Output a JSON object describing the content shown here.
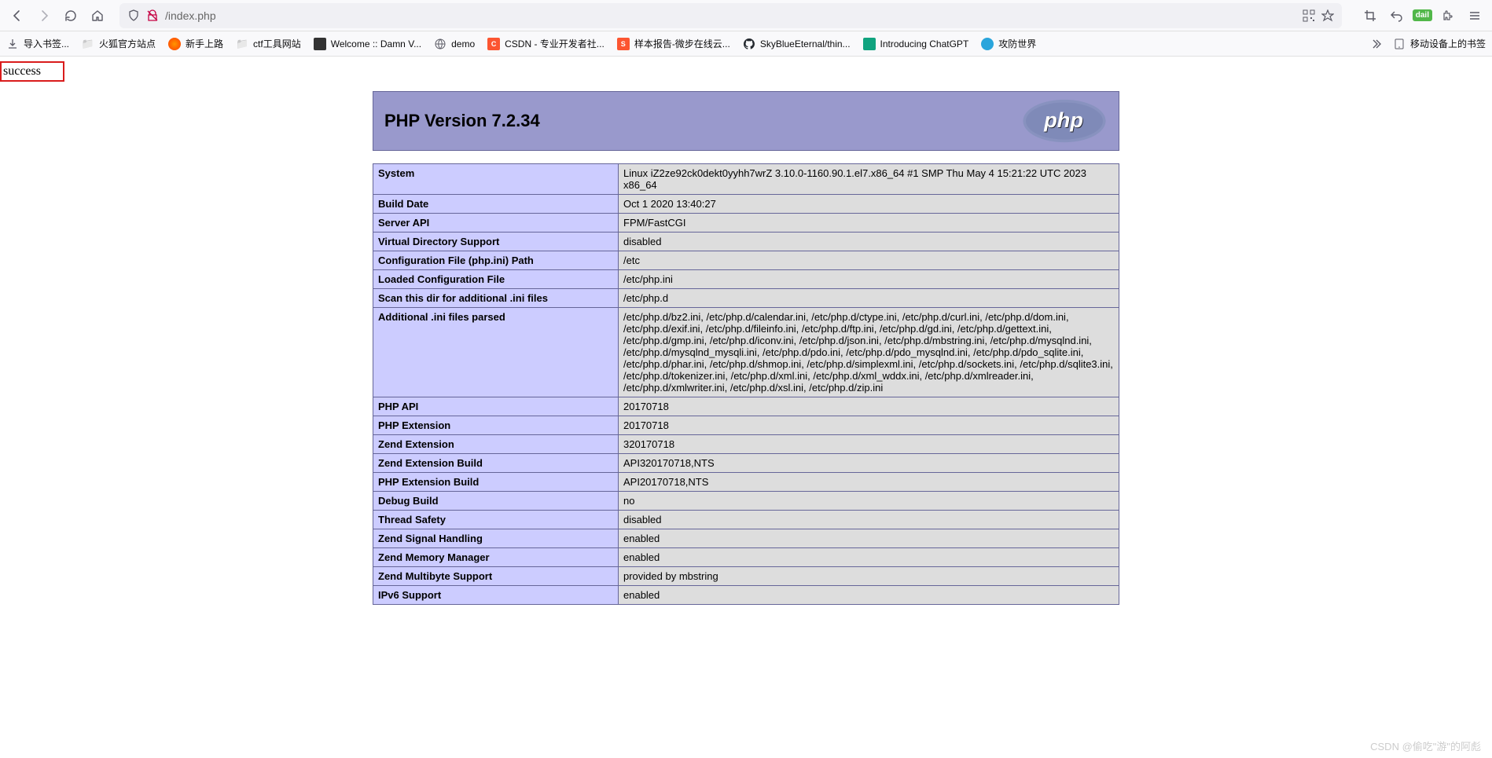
{
  "browser": {
    "url_display": "/index.php",
    "dail_text": "dail"
  },
  "bookmarks": {
    "items": [
      {
        "label": "导入书签..."
      },
      {
        "label": "火狐官方站点"
      },
      {
        "label": "新手上路"
      },
      {
        "label": "ctf工具网站"
      },
      {
        "label": "Welcome :: Damn V..."
      },
      {
        "label": "demo"
      },
      {
        "label": "CSDN - 专业开发者社..."
      },
      {
        "label": "样本报告-微步在线云..."
      },
      {
        "label": "SkyBlueEternal/thin..."
      },
      {
        "label": "Introducing ChatGPT"
      },
      {
        "label": "攻防世界"
      }
    ],
    "mobile": "移动设备上的书签"
  },
  "page": {
    "success_text": "success",
    "php_title": "PHP Version 7.2.34",
    "rows": [
      {
        "k": "System",
        "v": "Linux iZ2ze92ck0dekt0yyhh7wrZ 3.10.0-1160.90.1.el7.x86_64 #1 SMP Thu May 4 15:21:22 UTC 2023 x86_64"
      },
      {
        "k": "Build Date",
        "v": "Oct 1 2020 13:40:27"
      },
      {
        "k": "Server API",
        "v": "FPM/FastCGI"
      },
      {
        "k": "Virtual Directory Support",
        "v": "disabled"
      },
      {
        "k": "Configuration File (php.ini) Path",
        "v": "/etc"
      },
      {
        "k": "Loaded Configuration File",
        "v": "/etc/php.ini"
      },
      {
        "k": "Scan this dir for additional .ini files",
        "v": "/etc/php.d"
      },
      {
        "k": "Additional .ini files parsed",
        "v": "/etc/php.d/bz2.ini, /etc/php.d/calendar.ini, /etc/php.d/ctype.ini, /etc/php.d/curl.ini, /etc/php.d/dom.ini, /etc/php.d/exif.ini, /etc/php.d/fileinfo.ini, /etc/php.d/ftp.ini, /etc/php.d/gd.ini, /etc/php.d/gettext.ini, /etc/php.d/gmp.ini, /etc/php.d/iconv.ini, /etc/php.d/json.ini, /etc/php.d/mbstring.ini, /etc/php.d/mysqlnd.ini, /etc/php.d/mysqlnd_mysqli.ini, /etc/php.d/pdo.ini, /etc/php.d/pdo_mysqlnd.ini, /etc/php.d/pdo_sqlite.ini, /etc/php.d/phar.ini, /etc/php.d/shmop.ini, /etc/php.d/simplexml.ini, /etc/php.d/sockets.ini, /etc/php.d/sqlite3.ini, /etc/php.d/tokenizer.ini, /etc/php.d/xml.ini, /etc/php.d/xml_wddx.ini, /etc/php.d/xmlreader.ini, /etc/php.d/xmlwriter.ini, /etc/php.d/xsl.ini, /etc/php.d/zip.ini"
      },
      {
        "k": "PHP API",
        "v": "20170718"
      },
      {
        "k": "PHP Extension",
        "v": "20170718"
      },
      {
        "k": "Zend Extension",
        "v": "320170718"
      },
      {
        "k": "Zend Extension Build",
        "v": "API320170718,NTS"
      },
      {
        "k": "PHP Extension Build",
        "v": "API20170718,NTS"
      },
      {
        "k": "Debug Build",
        "v": "no"
      },
      {
        "k": "Thread Safety",
        "v": "disabled"
      },
      {
        "k": "Zend Signal Handling",
        "v": "enabled"
      },
      {
        "k": "Zend Memory Manager",
        "v": "enabled"
      },
      {
        "k": "Zend Multibyte Support",
        "v": "provided by mbstring"
      },
      {
        "k": "IPv6 Support",
        "v": "enabled"
      }
    ]
  },
  "watermark": "CSDN @偷吃\"游\"的阿彪"
}
